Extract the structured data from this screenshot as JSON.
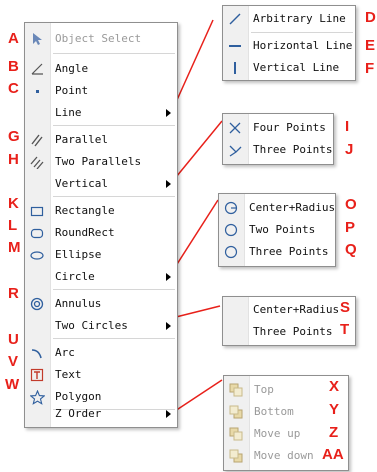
{
  "colors": {
    "annotation": "#e8201a",
    "menu_border": "#8f8f8f",
    "gutter": "#f0f0f0",
    "icon_blue": "#2f5f9e"
  },
  "main_menu": {
    "items": [
      {
        "label": "Object Select",
        "icon": "cursor-icon",
        "tag": "A",
        "disabled": true
      },
      {
        "label": "Angle",
        "icon": "angle-icon",
        "tag": "B"
      },
      {
        "label": "Point",
        "icon": "point-icon",
        "tag": "C"
      },
      {
        "label": "Line",
        "icon": "",
        "tag": "",
        "submenu": true
      },
      {
        "label": "Parallel",
        "icon": "parallel-icon",
        "tag": "G"
      },
      {
        "label": "Two Parallels",
        "icon": "two-parallels-icon",
        "tag": "H"
      },
      {
        "label": "Vertical",
        "icon": "",
        "tag": "",
        "submenu": true
      },
      {
        "label": "Rectangle",
        "icon": "rectangle-icon",
        "tag": "K"
      },
      {
        "label": "RoundRect",
        "icon": "roundrect-icon",
        "tag": "L"
      },
      {
        "label": "Ellipse",
        "icon": "ellipse-icon",
        "tag": "M"
      },
      {
        "label": "Circle",
        "icon": "",
        "tag": "",
        "submenu": true
      },
      {
        "label": "Annulus",
        "icon": "annulus-icon",
        "tag": "R"
      },
      {
        "label": "Two Circles",
        "icon": "",
        "tag": "",
        "submenu": true
      },
      {
        "label": "Arc",
        "icon": "arc-icon",
        "tag": "U"
      },
      {
        "label": "Text",
        "icon": "text-icon",
        "tag": "V"
      },
      {
        "label": "Polygon",
        "icon": "polygon-icon",
        "tag": "W"
      },
      {
        "label": "Z Order",
        "icon": "",
        "tag": "",
        "submenu": true
      }
    ]
  },
  "line_menu": {
    "items": [
      {
        "label": "Arbitrary Line",
        "icon": "arbitrary-line-icon",
        "tag": "D"
      },
      {
        "label": "Horizontal Line",
        "icon": "horizontal-line-icon",
        "tag": "E"
      },
      {
        "label": "Vertical Line",
        "icon": "vertical-line-icon",
        "tag": "F"
      }
    ]
  },
  "vertical_menu": {
    "items": [
      {
        "label": "Four Points",
        "icon": "four-points-icon",
        "tag": "I"
      },
      {
        "label": "Three Points",
        "icon": "three-points-icon",
        "tag": "J"
      }
    ]
  },
  "circle_menu": {
    "items": [
      {
        "label": "Center+Radius",
        "icon": "center-radius-icon",
        "tag": "O"
      },
      {
        "label": "Two Points",
        "icon": "circle-two-points-icon",
        "tag": "P"
      },
      {
        "label": "Three Points",
        "icon": "circle-three-points-icon",
        "tag": "Q"
      }
    ]
  },
  "two_circles_menu": {
    "items": [
      {
        "label": "Center+Radius",
        "tag": "S"
      },
      {
        "label": "Three Points",
        "tag": "T"
      }
    ]
  },
  "zorder_menu": {
    "items": [
      {
        "label": "Top",
        "icon": "bring-to-top-icon",
        "tag": "X"
      },
      {
        "label": "Bottom",
        "icon": "send-to-bottom-icon",
        "tag": "Y"
      },
      {
        "label": "Move up",
        "icon": "move-up-icon",
        "tag": "Z"
      },
      {
        "label": "Move down",
        "icon": "move-down-icon",
        "tag": "AA"
      }
    ]
  }
}
